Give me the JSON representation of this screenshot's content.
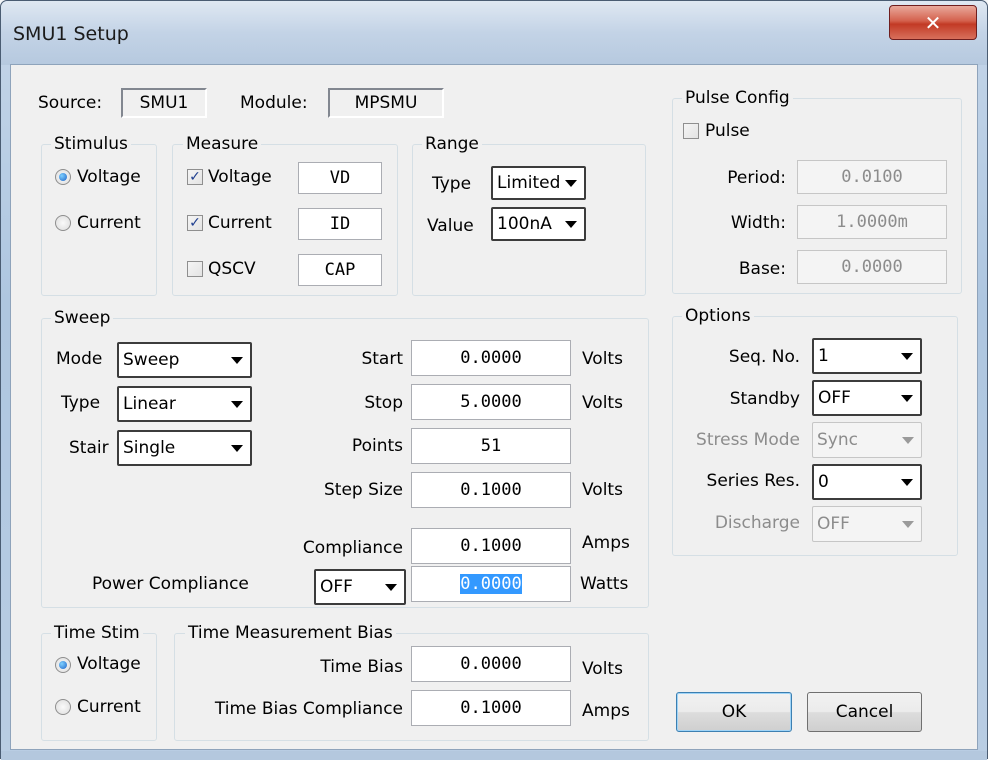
{
  "window": {
    "title": "SMU1 Setup",
    "close_symbol": "✕"
  },
  "source": {
    "label": "Source:",
    "value": "SMU1"
  },
  "module": {
    "label": "Module:",
    "value": "MPSMU"
  },
  "stimulus": {
    "title": "Stimulus",
    "options": [
      {
        "label": "Voltage",
        "selected": true
      },
      {
        "label": "Current",
        "selected": false
      }
    ]
  },
  "measure": {
    "title": "Measure",
    "rows": [
      {
        "label": "Voltage",
        "checked": true,
        "name": "VD"
      },
      {
        "label": "Current",
        "checked": true,
        "name": "ID"
      },
      {
        "label": "QSCV",
        "checked": false,
        "name": "CAP"
      }
    ]
  },
  "range": {
    "title": "Range",
    "type_label": "Type",
    "type_value": "Limited",
    "value_label": "Value",
    "value_value": "100nA"
  },
  "pulse": {
    "title": "Pulse Config",
    "checkbox_label": "Pulse",
    "checked": false,
    "period_label": "Period:",
    "period_value": "0.0100",
    "width_label": "Width:",
    "width_value": "1.0000m",
    "base_label": "Base:",
    "base_value": "0.0000"
  },
  "sweep": {
    "title": "Sweep",
    "mode_label": "Mode",
    "mode_value": "Sweep",
    "type_label": "Type",
    "type_value": "Linear",
    "stair_label": "Stair",
    "stair_value": "Single",
    "start_label": "Start",
    "start_value": "0.0000",
    "start_unit": "Volts",
    "stop_label": "Stop",
    "stop_value": "5.0000",
    "stop_unit": "Volts",
    "points_label": "Points",
    "points_value": "51",
    "step_label": "Step Size",
    "step_value": "0.1000",
    "step_unit": "Volts",
    "compliance_label": "Compliance",
    "compliance_value": "0.1000",
    "compliance_unit": "Amps",
    "power_label": "Power Compliance",
    "power_state": "OFF",
    "power_value": "0.0000",
    "power_unit": "Watts"
  },
  "options": {
    "title": "Options",
    "seq_label": "Seq. No.",
    "seq_value": "1",
    "standby_label": "Standby",
    "standby_value": "OFF",
    "stress_label": "Stress Mode",
    "stress_value": "Sync",
    "series_label": "Series Res.",
    "series_value": "0",
    "discharge_label": "Discharge",
    "discharge_value": "OFF"
  },
  "time_stim": {
    "title": "Time Stim",
    "options": [
      {
        "label": "Voltage",
        "selected": true
      },
      {
        "label": "Current",
        "selected": false
      }
    ]
  },
  "time_bias": {
    "title": "Time Measurement Bias",
    "bias_label": "Time Bias",
    "bias_value": "0.0000",
    "bias_unit": "Volts",
    "comp_label": "Time Bias Compliance",
    "comp_value": "0.1000",
    "comp_unit": "Amps"
  },
  "buttons": {
    "ok": "OK",
    "cancel": "Cancel"
  }
}
